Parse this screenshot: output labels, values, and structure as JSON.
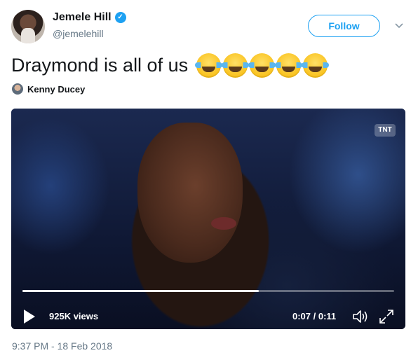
{
  "author": {
    "display_name": "Jemele Hill",
    "handle": "@jemelehill",
    "verified_icon": "verified-badge-icon"
  },
  "follow_button": {
    "label": "Follow"
  },
  "tweet": {
    "text": "Draymond is all of us",
    "emoji_count": 5,
    "emoji_icon": "face-with-tears-of-joy-icon",
    "attribution": "Kenny Ducey",
    "timestamp": "9:37 PM - 18 Feb 2018"
  },
  "video": {
    "watermark": "TNT",
    "views": "925K views",
    "time": "0:07 / 0:11",
    "progress": 0.636
  },
  "colors": {
    "accent": "#1da1f2",
    "secondary_text": "#657786",
    "primary_text": "#14171a"
  }
}
